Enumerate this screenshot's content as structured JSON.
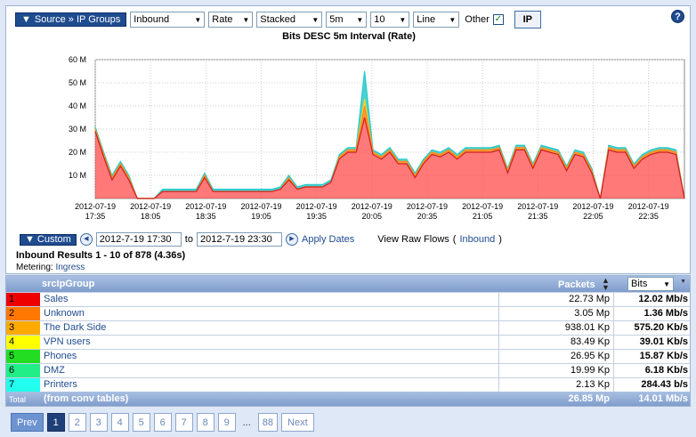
{
  "toolbar": {
    "groups_label": "Source » IP Groups",
    "direction": "Inbound",
    "metric": "Rate",
    "mode": "Stacked",
    "interval": "5m",
    "count": "10",
    "style": "Line",
    "other_label": "Other",
    "other_checked": "✓",
    "ip_label": "IP",
    "help": "?"
  },
  "chart_data": {
    "type": "area",
    "title": "Bits DESC 5m Interval (Rate)",
    "ylim": [
      0,
      60
    ],
    "yticks": [
      "10 M",
      "20 M",
      "30 M",
      "40 M",
      "50 M",
      "60 M"
    ],
    "xticks": [
      [
        "2012-07-19",
        "17:35"
      ],
      [
        "2012-07-19",
        "18:05"
      ],
      [
        "2012-07-19",
        "18:35"
      ],
      [
        "2012-07-19",
        "19:05"
      ],
      [
        "2012-07-19",
        "19:35"
      ],
      [
        "2012-07-19",
        "20:05"
      ],
      [
        "2012-07-19",
        "20:35"
      ],
      [
        "2012-07-19",
        "21:05"
      ],
      [
        "2012-07-19",
        "21:35"
      ],
      [
        "2012-07-19",
        "22:05"
      ],
      [
        "2012-07-19",
        "22:35"
      ]
    ],
    "grid": true,
    "stacked": true,
    "series_colors": [
      "#ff4040",
      "#ff8a1a",
      "#ffd21a",
      "#2ac9c9"
    ],
    "series": [
      {
        "values": [
          29,
          18,
          8,
          14,
          8,
          0,
          0,
          0,
          3,
          3,
          3,
          3,
          3,
          9,
          3,
          3,
          3,
          3,
          3,
          3,
          3,
          3,
          4,
          8,
          4,
          5,
          5,
          5,
          7,
          17,
          20,
          20,
          35,
          19,
          17,
          20,
          15,
          15,
          9,
          15,
          19,
          18,
          20,
          17,
          20,
          20,
          20,
          20,
          21,
          11,
          21,
          21,
          13,
          21,
          20,
          19,
          12,
          19,
          18,
          11,
          0,
          21,
          20,
          20,
          13,
          17,
          19,
          20,
          20,
          19,
          0
        ]
      },
      {
        "values": [
          1,
          1,
          1,
          1,
          1,
          0,
          0,
          0,
          0,
          0,
          0,
          0,
          0,
          1,
          0,
          0,
          0,
          0,
          0,
          0,
          0,
          0,
          0,
          1,
          0,
          0,
          0,
          0,
          0,
          1,
          1,
          1,
          5,
          1,
          1,
          1,
          1,
          1,
          1,
          1,
          1,
          1,
          1,
          1,
          1,
          1,
          1,
          1,
          1,
          1,
          1,
          1,
          1,
          1,
          1,
          1,
          1,
          1,
          1,
          1,
          0,
          1,
          1,
          1,
          1,
          1,
          1,
          1,
          1,
          1,
          0
        ]
      },
      {
        "values": [
          0,
          0,
          0,
          0,
          0,
          0,
          0,
          0,
          0,
          0,
          0,
          0,
          0,
          0,
          0,
          0,
          0,
          0,
          0,
          0,
          0,
          0,
          0,
          0,
          0,
          0,
          0,
          0,
          0,
          0,
          0,
          0,
          3,
          0,
          0,
          0,
          0,
          0,
          0,
          0,
          0,
          0,
          0,
          0,
          0,
          0,
          0,
          0,
          0,
          0,
          0,
          0,
          0,
          0,
          0,
          0,
          0,
          0,
          0,
          0,
          0,
          0,
          0,
          0,
          0,
          0,
          0,
          0,
          0,
          0,
          0
        ]
      },
      {
        "values": [
          1,
          1,
          1,
          1,
          1,
          0,
          0,
          0,
          1,
          1,
          1,
          1,
          1,
          1,
          1,
          1,
          1,
          1,
          1,
          1,
          1,
          1,
          1,
          1,
          1,
          1,
          1,
          1,
          1,
          1,
          1,
          1,
          12,
          1,
          1,
          1,
          1,
          1,
          1,
          1,
          1,
          1,
          1,
          1,
          1,
          1,
          1,
          1,
          1,
          1,
          1,
          1,
          1,
          1,
          1,
          1,
          1,
          1,
          1,
          1,
          0,
          1,
          1,
          1,
          1,
          1,
          1,
          1,
          1,
          1,
          0
        ]
      }
    ]
  },
  "dates": {
    "custom_label": "Custom",
    "from": "2012-7-19 17:30",
    "to_label": "to",
    "to": "2012-7-19 23:30",
    "apply_label": "Apply Dates",
    "raw_flows_label": "View Raw Flows",
    "raw_flows_open": "(",
    "raw_flows_link": "Inbound",
    "raw_flows_close": ")"
  },
  "results": {
    "title": "Inbound Results 1 - 10 of 878 (4.36s)",
    "metering_label": "Metering:",
    "metering_value": "Ingress"
  },
  "table": {
    "col_name": "srcIpGroup",
    "col_packets": "Packets",
    "col_bits_select": "Bits",
    "rows": [
      {
        "rank": "1",
        "color": "#ee0000",
        "name": "Sales",
        "packets": "22.73 Mp",
        "bits": "12.02 Mb/s"
      },
      {
        "rank": "2",
        "color": "#ff7700",
        "name": "Unknown",
        "packets": "3.05 Mp",
        "bits": "1.36 Mb/s"
      },
      {
        "rank": "3",
        "color": "#ffaa00",
        "name": "The Dark Side",
        "packets": "938.01 Kp",
        "bits": "575.20 Kb/s"
      },
      {
        "rank": "4",
        "color": "#ffff00",
        "name": "VPN users",
        "packets": "83.49 Kp",
        "bits": "39.01 Kb/s"
      },
      {
        "rank": "5",
        "color": "#22dd22",
        "name": "Phones",
        "packets": "26.95 Kp",
        "bits": "15.87 Kb/s"
      },
      {
        "rank": "6",
        "color": "#22ee88",
        "name": "DMZ",
        "packets": "19.99 Kp",
        "bits": "6.18 Kb/s"
      },
      {
        "rank": "7",
        "color": "#22ffee",
        "name": "Printers",
        "packets": "2.13 Kp",
        "bits": "284.43 b/s"
      }
    ],
    "total_label": "Total",
    "total_name": "(from conv tables)",
    "total_packets": "26.85 Mp",
    "total_bits": "14.01 Mb/s"
  },
  "pager": {
    "prev": "Prev",
    "pages": [
      "1",
      "2",
      "3",
      "4",
      "5",
      "6",
      "7",
      "8",
      "9"
    ],
    "ellipsis": "...",
    "last": "88",
    "next": "Next"
  }
}
